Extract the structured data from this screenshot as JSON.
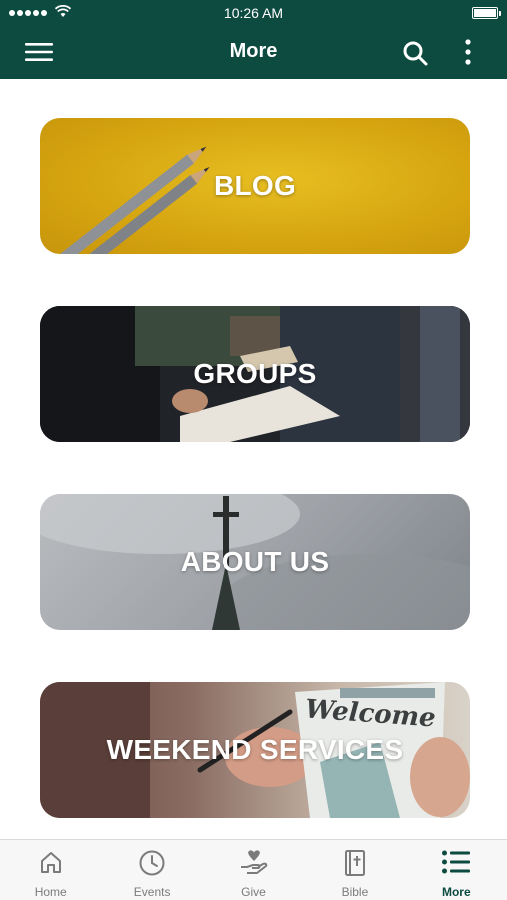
{
  "status_bar": {
    "time": "10:26 AM"
  },
  "header": {
    "title": "More"
  },
  "cards": [
    {
      "label": "BLOG"
    },
    {
      "label": "GROUPS"
    },
    {
      "label": "ABOUT US"
    },
    {
      "label": "WEEKEND SERVICES"
    }
  ],
  "card_artwork": {
    "weekend_sign_text": "Welcome"
  },
  "tabs": [
    {
      "label": "Home",
      "icon": "home-icon"
    },
    {
      "label": "Events",
      "icon": "clock-icon"
    },
    {
      "label": "Give",
      "icon": "give-hand-heart-icon"
    },
    {
      "label": "Bible",
      "icon": "bible-icon"
    },
    {
      "label": "More",
      "icon": "list-icon",
      "active": true
    }
  ],
  "colors": {
    "brand": "#0d4a3f",
    "tab_inactive": "#7b7b7b",
    "blog_card": "#d5a40f"
  }
}
